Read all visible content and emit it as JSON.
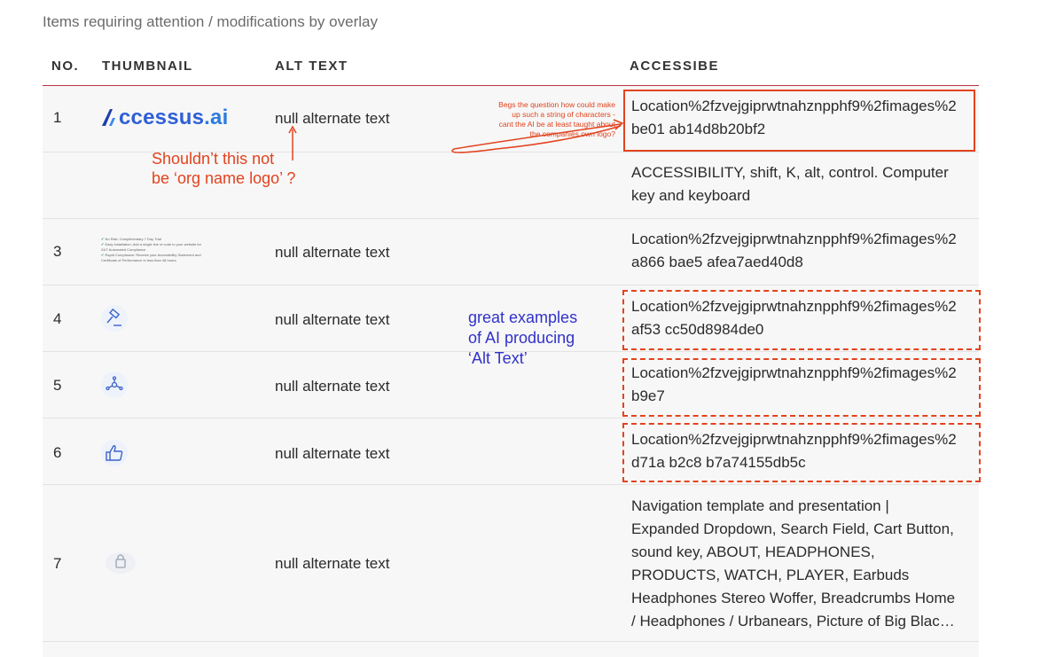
{
  "caption": "Items requiring attention / modifications by overlay",
  "columns": {
    "no": "NO.",
    "thumbnail": "THUMBNAIL",
    "alt_text": "ALT TEXT",
    "accessibe": "ACCESSIBE"
  },
  "rows": [
    {
      "no": "1",
      "alt": "null alternate text",
      "accessibe_1": "Location%2fzvejgiprwtnahznpphf9%2fimages%2",
      "accessibe_2": "be01 ab14d8b20bf2",
      "thumb": "accessus-logo"
    },
    {
      "no": "",
      "alt": "",
      "accessibe_1": "ACCESSIBILITY, shift, K, alt, control. Computer",
      "accessibe_2": "key and keyboard",
      "thumb": ""
    },
    {
      "no": "3",
      "alt": "null alternate text",
      "accessibe_1": "Location%2fzvejgiprwtnahznpphf9%2fimages%2",
      "accessibe_2": "a866 bae5 afea7aed40d8",
      "thumb": "feature-list"
    },
    {
      "no": "4",
      "alt": "null alternate text",
      "accessibe_1": "Location%2fzvejgiprwtnahznpphf9%2fimages%2",
      "accessibe_2": "af53 cc50d8984de0",
      "thumb": "gavel-icon"
    },
    {
      "no": "5",
      "alt": "null alternate text",
      "accessibe_1": "Location%2fzvejgiprwtnahznpphf9%2fimages%2",
      "accessibe_2": "b9e7",
      "thumb": "network-icon"
    },
    {
      "no": "6",
      "alt": "null alternate text",
      "accessibe_1": "Location%2fzvejgiprwtnahznpphf9%2fimages%2",
      "accessibe_2": "d71a b2c8 b7a74155db5c",
      "thumb": "thumbs-up-icon"
    },
    {
      "no": "7",
      "alt": "null alternate text",
      "accessibe_lines": [
        "Navigation template and presentation |",
        "Expanded Dropdown, Search Field, Cart Button,",
        "sound key, ABOUT, HEADPHONES,",
        "PRODUCTS, WATCH, PLAYER, Earbuds",
        "Headphones Stereo Woffer, Breadcrumbs Home",
        "/ Headphones / Urbanears, Picture of Big Blac…"
      ],
      "thumb": "lock-icon"
    }
  ],
  "logo": {
    "main": "ccessus",
    "ai": ".ai"
  },
  "thumb_feature_list": [
    "No Risk: Complimentary 7 Day Trial",
    "Easy Installation: Add a single line of code to your website for 24/7 Automated Compliance",
    "Rapid Compliance: Receive your Accessibility Statement and Certificate of Performance in less than 48 hours."
  ],
  "annotations": {
    "question_line1": "Shouldn’t this not",
    "question_line2": "be ‘org name logo’ ?",
    "begs_lines": [
      "Begs the question how could make",
      "up such a string of characters -",
      "cant the AI be at least taught about",
      "the companies own logo?"
    ],
    "great_lines": [
      "great examples",
      "of AI producing",
      "‘Alt Text’"
    ]
  },
  "colors": {
    "accent_red": "#e2431e",
    "header_rule": "#b9323e",
    "annotation_blue": "#3131c9",
    "logo_blue": "#2e5fd6"
  }
}
